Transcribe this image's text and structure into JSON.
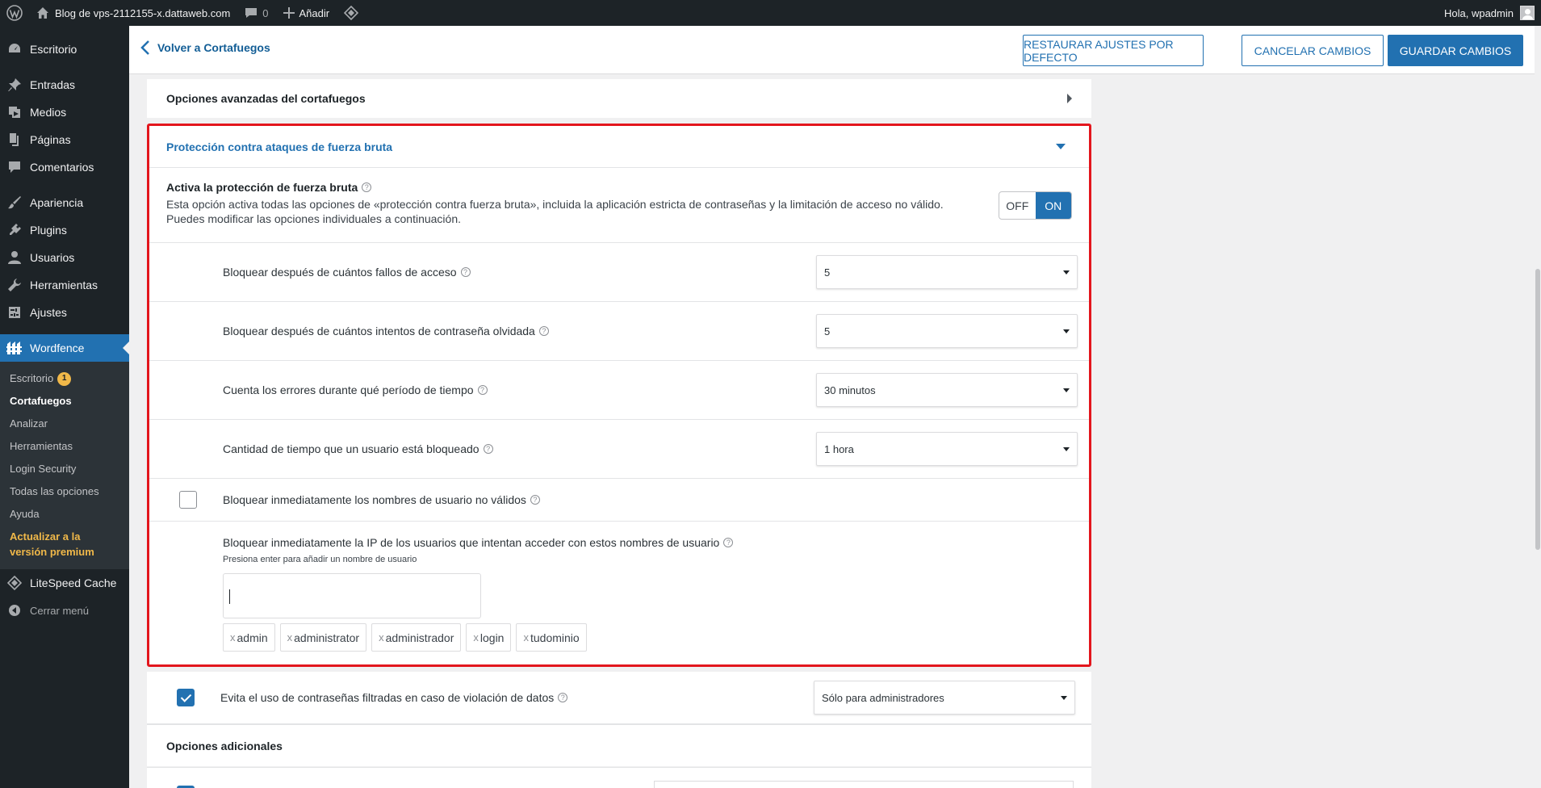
{
  "adminbar": {
    "site_name": "Blog de vps-2112155-x.dattaweb.com",
    "comments_count": "0",
    "add_new": "Añadir",
    "greeting": "Hola, wpadmin"
  },
  "sidebar": {
    "items": [
      {
        "label": "Escritorio",
        "icon": "dashboard-icon"
      },
      {
        "label": "Entradas",
        "icon": "pin-icon"
      },
      {
        "label": "Medios",
        "icon": "media-icon"
      },
      {
        "label": "Páginas",
        "icon": "pages-icon"
      },
      {
        "label": "Comentarios",
        "icon": "comment-icon"
      },
      {
        "label": "Apariencia",
        "icon": "brush-icon"
      },
      {
        "label": "Plugins",
        "icon": "plugin-icon"
      },
      {
        "label": "Usuarios",
        "icon": "user-icon"
      },
      {
        "label": "Herramientas",
        "icon": "wrench-icon"
      },
      {
        "label": "Ajustes",
        "icon": "settings-icon"
      },
      {
        "label": "Wordfence",
        "icon": "wordfence-icon"
      }
    ],
    "submenu": [
      {
        "label": "Escritorio",
        "badge": "1"
      },
      {
        "label": "Cortafuegos"
      },
      {
        "label": "Analizar"
      },
      {
        "label": "Herramientas"
      },
      {
        "label": "Login Security"
      },
      {
        "label": "Todas las opciones"
      },
      {
        "label": "Ayuda"
      },
      {
        "label": "Actualizar a la versión premium"
      }
    ],
    "litespeed": "LiteSpeed Cache",
    "collapse": "Cerrar menú"
  },
  "topbar": {
    "back_label": "Volver a Cortafuegos",
    "restore_label": "RESTAURAR AJUSTES POR DEFECTO",
    "cancel_label": "CANCELAR CAMBIOS",
    "save_label": "GUARDAR CAMBIOS"
  },
  "advanced": {
    "title": "Opciones avanzadas del cortafuegos"
  },
  "bruteforce": {
    "title": "Protección contra ataques de fuerza bruta",
    "enable_label": "Activa la protección de fuerza bruta",
    "enable_desc": "Esta opción activa todas las opciones de «protección contra fuerza bruta», incluida la aplicación estricta de contraseñas y la limitación de acceso no válido. Puedes modificar las opciones individuales a continuación.",
    "toggle_off": "OFF",
    "toggle_on": "ON",
    "rows": [
      {
        "label": "Bloquear después de cuántos fallos de acceso",
        "value": "5"
      },
      {
        "label": "Bloquear después de cuántos intentos de contraseña olvidada",
        "value": "5"
      },
      {
        "label": "Cuenta los errores durante qué período de tiempo",
        "value": "30 minutos"
      },
      {
        "label": "Cantidad de tiempo que un usuario está bloqueado",
        "value": "1 hora"
      }
    ],
    "invalid_usernames_label": "Bloquear inmediatamente los nombres de usuario no válidos",
    "ip_block_label": "Bloquear inmediatamente la IP de los usuarios que intentan acceder con estos nombres de usuario",
    "ip_block_hint": "Presiona enter para añadir un nombre de usuario",
    "tag_remove": "x",
    "tags": [
      "admin",
      "administrator",
      "administrador",
      "login",
      "tudominio"
    ]
  },
  "leaked": {
    "label": "Evita el uso de contraseñas filtradas en caso de violación de datos",
    "value": "Sólo para administradores"
  },
  "additional": {
    "title": "Opciones adicionales"
  },
  "colors": {
    "accent": "#2271b1",
    "highlight_border": "#e3161d",
    "admin_dark": "#1d2327",
    "premium": "#f0b849"
  }
}
